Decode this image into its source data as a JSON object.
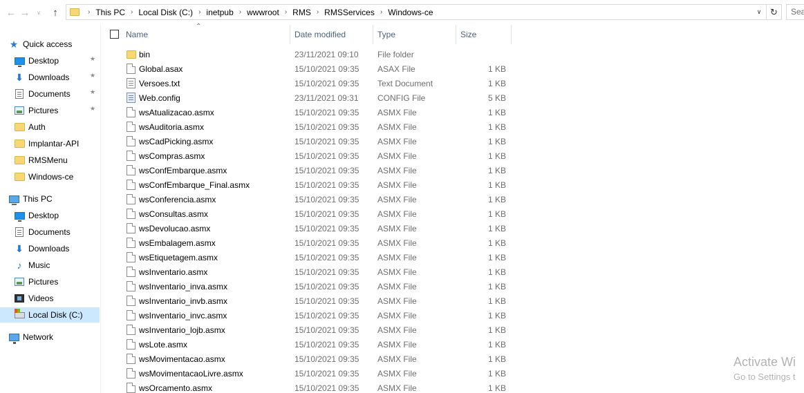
{
  "address_bar": {
    "breadcrumbs": [
      "This PC",
      "Local Disk (C:)",
      "inetpub",
      "wwwroot",
      "RMS",
      "RMSServices",
      "Windows-ce"
    ],
    "search_placeholder": "Sea"
  },
  "sidebar": {
    "quick_access_label": "Quick access",
    "quick_access": [
      {
        "label": "Desktop",
        "icon": "desktop-icon",
        "pinned": true
      },
      {
        "label": "Downloads",
        "icon": "download-icon",
        "pinned": true
      },
      {
        "label": "Documents",
        "icon": "documents-icon",
        "pinned": true
      },
      {
        "label": "Pictures",
        "icon": "pictures-icon",
        "pinned": true
      },
      {
        "label": "Auth",
        "icon": "folder-icon",
        "pinned": false
      },
      {
        "label": "Implantar-API",
        "icon": "folder-icon",
        "pinned": false
      },
      {
        "label": "RMSMenu",
        "icon": "folder-icon",
        "pinned": false
      },
      {
        "label": "Windows-ce",
        "icon": "folder-icon",
        "pinned": false
      }
    ],
    "this_pc_label": "This PC",
    "this_pc": [
      {
        "label": "Desktop",
        "icon": "desktop-icon"
      },
      {
        "label": "Documents",
        "icon": "documents-icon"
      },
      {
        "label": "Downloads",
        "icon": "download-icon"
      },
      {
        "label": "Music",
        "icon": "music-icon"
      },
      {
        "label": "Pictures",
        "icon": "pictures-icon"
      },
      {
        "label": "Videos",
        "icon": "videos-icon"
      },
      {
        "label": "Local Disk (C:)",
        "icon": "local-disk-icon",
        "selected": true
      }
    ],
    "network_label": "Network"
  },
  "columns": {
    "name": "Name",
    "date_modified": "Date modified",
    "type": "Type",
    "size": "Size"
  },
  "files": [
    {
      "name": "bin",
      "date": "23/11/2021 09:10",
      "type": "File folder",
      "size": "",
      "icon": "folder"
    },
    {
      "name": "Global.asax",
      "date": "15/10/2021 09:35",
      "type": "ASAX File",
      "size": "1 KB",
      "icon": "file"
    },
    {
      "name": "Versoes.txt",
      "date": "15/10/2021 09:35",
      "type": "Text Document",
      "size": "1 KB",
      "icon": "text"
    },
    {
      "name": "Web.config",
      "date": "23/11/2021 09:31",
      "type": "CONFIG File",
      "size": "5 KB",
      "icon": "config"
    },
    {
      "name": "wsAtualizacao.asmx",
      "date": "15/10/2021 09:35",
      "type": "ASMX File",
      "size": "1 KB",
      "icon": "file"
    },
    {
      "name": "wsAuditoria.asmx",
      "date": "15/10/2021 09:35",
      "type": "ASMX File",
      "size": "1 KB",
      "icon": "file"
    },
    {
      "name": "wsCadPicking.asmx",
      "date": "15/10/2021 09:35",
      "type": "ASMX File",
      "size": "1 KB",
      "icon": "file"
    },
    {
      "name": "wsCompras.asmx",
      "date": "15/10/2021 09:35",
      "type": "ASMX File",
      "size": "1 KB",
      "icon": "file"
    },
    {
      "name": "wsConfEmbarque.asmx",
      "date": "15/10/2021 09:35",
      "type": "ASMX File",
      "size": "1 KB",
      "icon": "file"
    },
    {
      "name": "wsConfEmbarque_Final.asmx",
      "date": "15/10/2021 09:35",
      "type": "ASMX File",
      "size": "1 KB",
      "icon": "file"
    },
    {
      "name": "wsConferencia.asmx",
      "date": "15/10/2021 09:35",
      "type": "ASMX File",
      "size": "1 KB",
      "icon": "file"
    },
    {
      "name": "wsConsultas.asmx",
      "date": "15/10/2021 09:35",
      "type": "ASMX File",
      "size": "1 KB",
      "icon": "file"
    },
    {
      "name": "wsDevolucao.asmx",
      "date": "15/10/2021 09:35",
      "type": "ASMX File",
      "size": "1 KB",
      "icon": "file"
    },
    {
      "name": "wsEmbalagem.asmx",
      "date": "15/10/2021 09:35",
      "type": "ASMX File",
      "size": "1 KB",
      "icon": "file"
    },
    {
      "name": "wsEtiquetagem.asmx",
      "date": "15/10/2021 09:35",
      "type": "ASMX File",
      "size": "1 KB",
      "icon": "file"
    },
    {
      "name": "wsInventario.asmx",
      "date": "15/10/2021 09:35",
      "type": "ASMX File",
      "size": "1 KB",
      "icon": "file"
    },
    {
      "name": "wsInventario_inva.asmx",
      "date": "15/10/2021 09:35",
      "type": "ASMX File",
      "size": "1 KB",
      "icon": "file"
    },
    {
      "name": "wsInventario_invb.asmx",
      "date": "15/10/2021 09:35",
      "type": "ASMX File",
      "size": "1 KB",
      "icon": "file"
    },
    {
      "name": "wsInventario_invc.asmx",
      "date": "15/10/2021 09:35",
      "type": "ASMX File",
      "size": "1 KB",
      "icon": "file"
    },
    {
      "name": "wsInventario_lojb.asmx",
      "date": "15/10/2021 09:35",
      "type": "ASMX File",
      "size": "1 KB",
      "icon": "file"
    },
    {
      "name": "wsLote.asmx",
      "date": "15/10/2021 09:35",
      "type": "ASMX File",
      "size": "1 KB",
      "icon": "file"
    },
    {
      "name": "wsMovimentacao.asmx",
      "date": "15/10/2021 09:35",
      "type": "ASMX File",
      "size": "1 KB",
      "icon": "file"
    },
    {
      "name": "wsMovimentacaoLivre.asmx",
      "date": "15/10/2021 09:35",
      "type": "ASMX File",
      "size": "1 KB",
      "icon": "file"
    },
    {
      "name": "wsOrcamento.asmx",
      "date": "15/10/2021 09:35",
      "type": "ASMX File",
      "size": "1 KB",
      "icon": "file"
    }
  ],
  "watermark": {
    "line1": "Activate Wi",
    "line2": "Go to Settings t"
  },
  "colors": {
    "selection": "#cce8ff",
    "header_text": "#4c607a",
    "secondary_text": "#6d6d6d",
    "folder": "#f8d775"
  }
}
